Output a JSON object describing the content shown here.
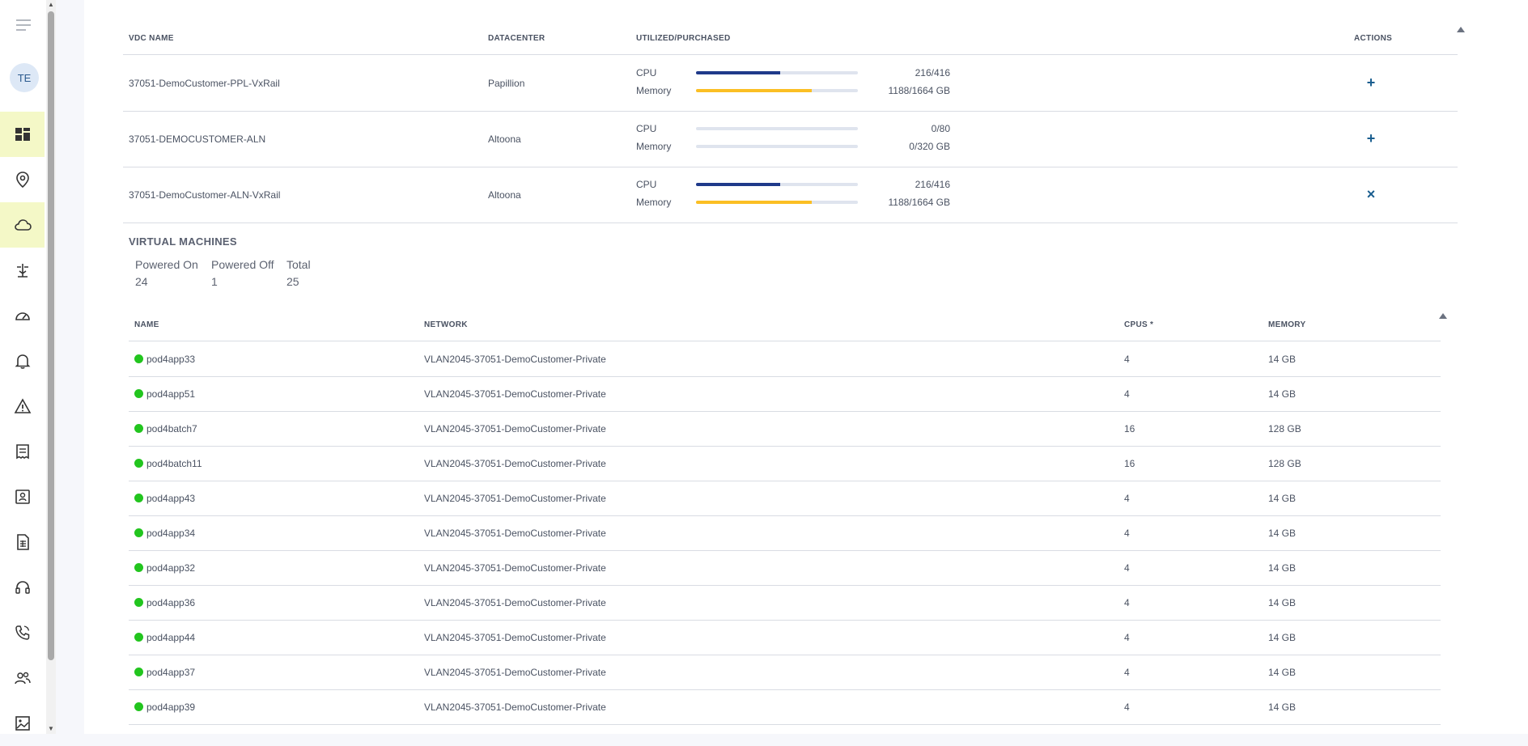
{
  "sidebar": {
    "avatar_initials": "TE",
    "items": [
      {
        "icon": "dashboard-icon",
        "active": true
      },
      {
        "icon": "location-pin-icon",
        "active": false
      },
      {
        "icon": "cloud-icon",
        "active": true
      },
      {
        "icon": "network-icon",
        "active": false
      },
      {
        "icon": "speedometer-icon",
        "active": false
      },
      {
        "icon": "bell-icon",
        "active": false
      },
      {
        "icon": "warning-icon",
        "active": false
      },
      {
        "icon": "receipt-icon",
        "active": false
      },
      {
        "icon": "contacts-book-icon",
        "active": false
      },
      {
        "icon": "spreadsheet-icon",
        "active": false
      },
      {
        "icon": "headset-icon",
        "active": false
      },
      {
        "icon": "phone-call-icon",
        "active": false
      },
      {
        "icon": "users-icon",
        "active": false
      },
      {
        "icon": "gallery-icon",
        "active": false
      }
    ]
  },
  "vdc_table": {
    "headers": {
      "name": "VDC NAME",
      "datacenter": "DATACENTER",
      "utilized": "UTILIZED/PURCHASED",
      "actions": "ACTIONS"
    },
    "rows": [
      {
        "name": "37051-DemoCustomer-PPL-VxRail",
        "datacenter": "Papillion",
        "cpu_label": "CPU",
        "cpu_value": "216/416",
        "cpu_fraction": 0.519,
        "mem_label": "Memory",
        "mem_value": "1188/1664 GB",
        "mem_fraction": 0.714,
        "action": "+"
      },
      {
        "name": "37051-DEMOCUSTOMER-ALN",
        "datacenter": "Altoona",
        "cpu_label": "CPU",
        "cpu_value": "0/80",
        "cpu_fraction": 0,
        "mem_label": "Memory",
        "mem_value": "0/320 GB",
        "mem_fraction": 0,
        "action": "+"
      },
      {
        "name": "37051-DemoCustomer-ALN-VxRail",
        "datacenter": "Altoona",
        "cpu_label": "CPU",
        "cpu_value": "216/416",
        "cpu_fraction": 0.519,
        "mem_label": "Memory",
        "mem_value": "1188/1664 GB",
        "mem_fraction": 0.714,
        "action": "×"
      }
    ]
  },
  "vm_section": {
    "title": "VIRTUAL MACHINES",
    "powered_on_label": "Powered On",
    "powered_on_value": "24",
    "powered_off_label": "Powered Off",
    "powered_off_value": "1",
    "total_label": "Total",
    "total_value": "25"
  },
  "vm_table": {
    "headers": {
      "name": "NAME",
      "network": "NETWORK",
      "cpus": "CPUS *",
      "memory": "MEMORY"
    },
    "rows": [
      {
        "name": "pod4app33",
        "network": "VLAN2045-37051-DemoCustomer-Private",
        "cpus": "4",
        "memory": "14 GB"
      },
      {
        "name": "pod4app51",
        "network": "VLAN2045-37051-DemoCustomer-Private",
        "cpus": "4",
        "memory": "14 GB"
      },
      {
        "name": "pod4batch7",
        "network": "VLAN2045-37051-DemoCustomer-Private",
        "cpus": "16",
        "memory": "128 GB"
      },
      {
        "name": "pod4batch11",
        "network": "VLAN2045-37051-DemoCustomer-Private",
        "cpus": "16",
        "memory": "128 GB"
      },
      {
        "name": "pod4app43",
        "network": "VLAN2045-37051-DemoCustomer-Private",
        "cpus": "4",
        "memory": "14 GB"
      },
      {
        "name": "pod4app34",
        "network": "VLAN2045-37051-DemoCustomer-Private",
        "cpus": "4",
        "memory": "14 GB"
      },
      {
        "name": "pod4app32",
        "network": "VLAN2045-37051-DemoCustomer-Private",
        "cpus": "4",
        "memory": "14 GB"
      },
      {
        "name": "pod4app36",
        "network": "VLAN2045-37051-DemoCustomer-Private",
        "cpus": "4",
        "memory": "14 GB"
      },
      {
        "name": "pod4app44",
        "network": "VLAN2045-37051-DemoCustomer-Private",
        "cpus": "4",
        "memory": "14 GB"
      },
      {
        "name": "pod4app37",
        "network": "VLAN2045-37051-DemoCustomer-Private",
        "cpus": "4",
        "memory": "14 GB"
      },
      {
        "name": "pod4app39",
        "network": "VLAN2045-37051-DemoCustomer-Private",
        "cpus": "4",
        "memory": "14 GB"
      }
    ]
  },
  "colors": {
    "cpu_bar": "#1f3a8a",
    "memory_bar": "#fbbf24",
    "bar_track": "#dfe4ee",
    "active_nav": "#f4f8c7",
    "status_on": "#22c51e",
    "action": "#1a5e8f"
  }
}
